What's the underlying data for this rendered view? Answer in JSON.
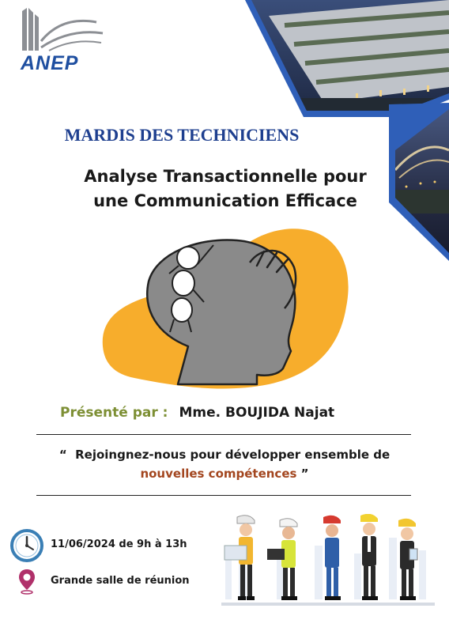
{
  "brand": {
    "name": "ANEP"
  },
  "header": {
    "series": "MARDIS DES TECHNICIENS",
    "title_line1": "Analyse Transactionnelle pour",
    "title_line2": "une Communication Efficace"
  },
  "presenter": {
    "label": "Présenté par :",
    "name": "Mme. BOUJIDA Najat"
  },
  "quote": {
    "open": "“",
    "text": "Rejoingnez-nous pour développer ensemble de",
    "highlight": "nouvelles compétences",
    "close": "”"
  },
  "event": {
    "date": "11/06/2024 de 9h à 13h",
    "location": "Grande salle de réunion"
  },
  "colors": {
    "brand_blue": "#1f4fa0",
    "series_blue": "#1e3f8f",
    "frame_blue": "#2f5fb8",
    "accent_orange": "#f7ad2c",
    "head_gray": "#8a8a8a",
    "label_olive": "#7d8f34",
    "highlight_brown": "#a3461f"
  },
  "icons": [
    "anep-logo",
    "clock-icon",
    "location-pin-icon"
  ]
}
